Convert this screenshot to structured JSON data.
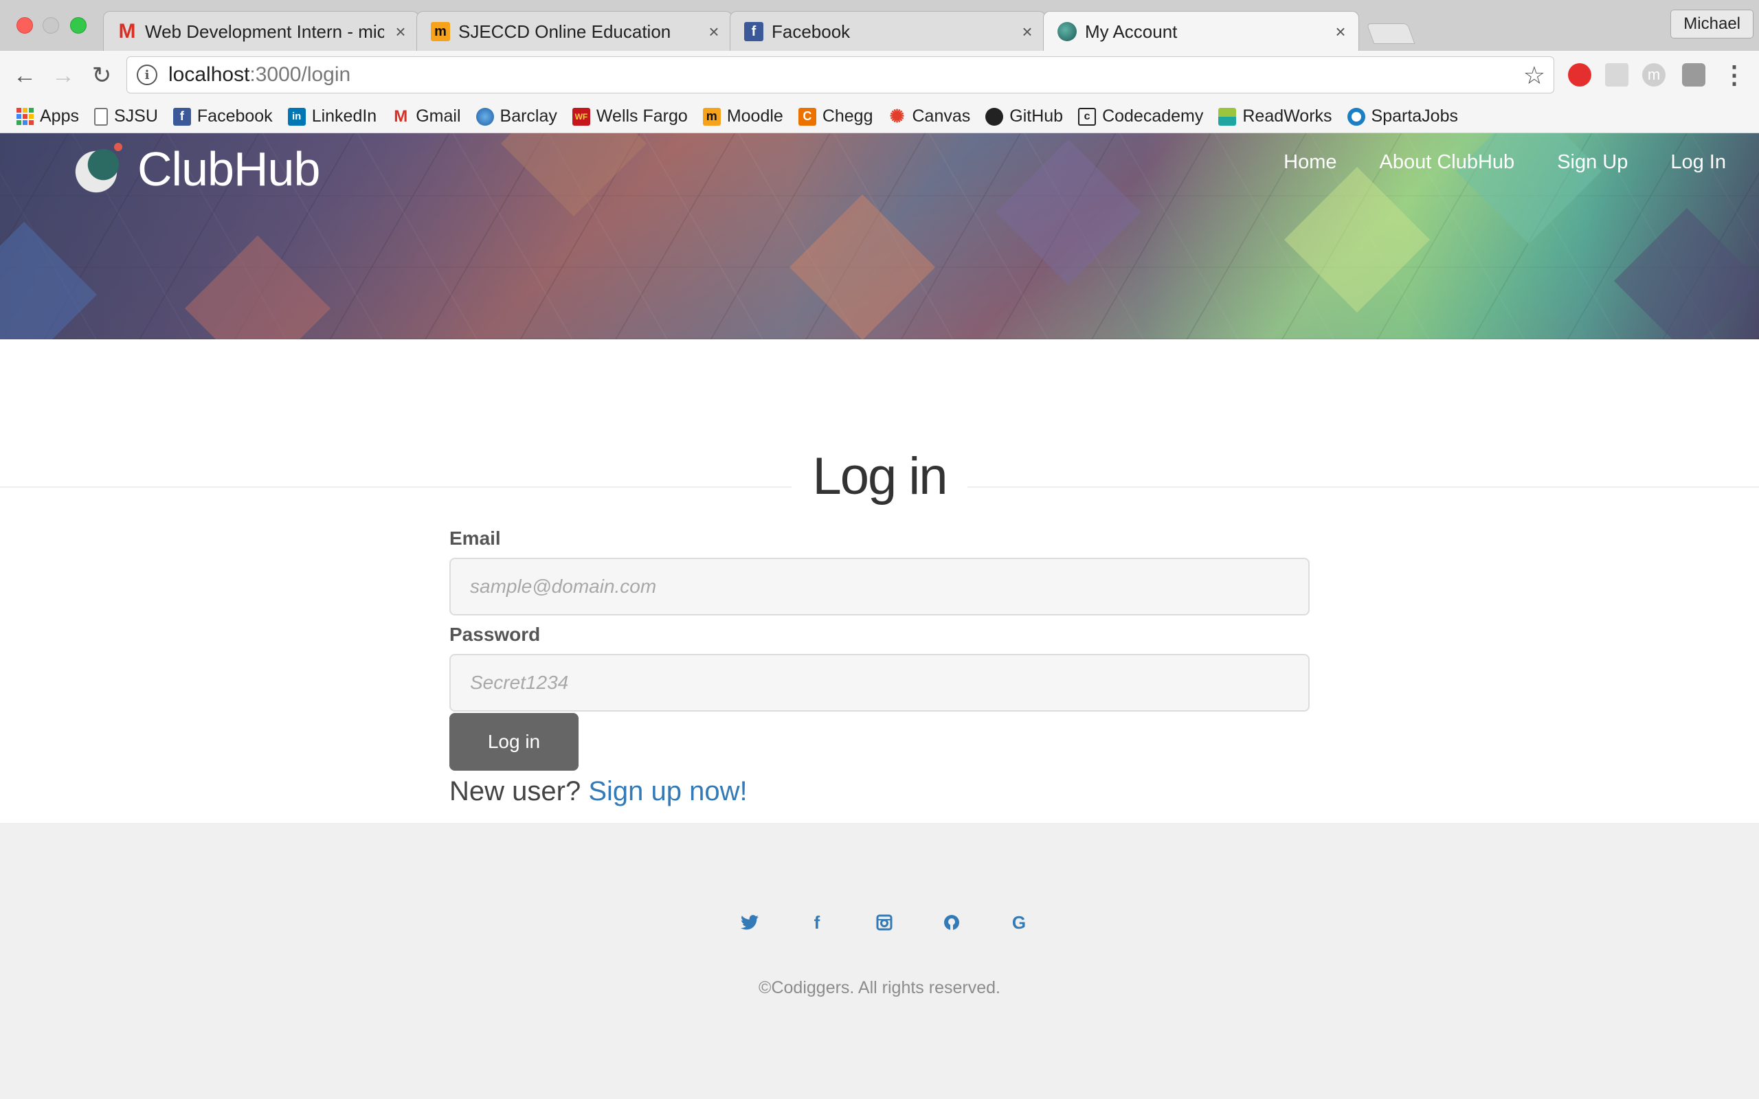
{
  "browser": {
    "tabs": [
      {
        "title": "Web Development Intern - mic",
        "favicon": "gmail-icon"
      },
      {
        "title": "SJECCD Online Education",
        "favicon": "moodle-icon"
      },
      {
        "title": "Facebook",
        "favicon": "facebook-icon"
      },
      {
        "title": "My Account",
        "favicon": "clubhub-icon",
        "active": true
      }
    ],
    "profile_name": "Michael",
    "url_host": "localhost",
    "url_path": ":3000/login",
    "bookmarks": [
      {
        "label": "Apps",
        "icon": "apps-grid-icon"
      },
      {
        "label": "SJSU",
        "icon": "document-icon"
      },
      {
        "label": "Facebook",
        "icon": "facebook-icon"
      },
      {
        "label": "LinkedIn",
        "icon": "linkedin-icon"
      },
      {
        "label": "Gmail",
        "icon": "gmail-icon"
      },
      {
        "label": "Barclay",
        "icon": "barclay-icon"
      },
      {
        "label": "Wells Fargo",
        "icon": "wells-fargo-icon"
      },
      {
        "label": "Moodle",
        "icon": "moodle-icon"
      },
      {
        "label": "Chegg",
        "icon": "chegg-icon"
      },
      {
        "label": "Canvas",
        "icon": "canvas-icon"
      },
      {
        "label": "GitHub",
        "icon": "github-icon"
      },
      {
        "label": "Codecademy",
        "icon": "codecademy-icon"
      },
      {
        "label": "ReadWorks",
        "icon": "readworks-icon"
      },
      {
        "label": "SpartaJobs",
        "icon": "spartajobs-icon"
      }
    ]
  },
  "site": {
    "brand": "ClubHub",
    "nav": [
      "Home",
      "About ClubHub",
      "Sign Up",
      "Log In"
    ]
  },
  "login": {
    "title": "Log in",
    "email_label": "Email",
    "email_placeholder": "sample@domain.com",
    "password_label": "Password",
    "password_placeholder": "Secret1234",
    "submit_label": "Log in",
    "new_user_text": "New user?",
    "signup_link": "Sign up now!"
  },
  "footer": {
    "social": [
      "twitter-icon",
      "facebook-icon",
      "instagram-icon",
      "github-icon",
      "google-icon"
    ],
    "copyright": "©Codiggers. All rights reserved."
  },
  "colors": {
    "link": "#337ab7",
    "button": "#666666",
    "footer_bg": "#f0f0f0"
  }
}
